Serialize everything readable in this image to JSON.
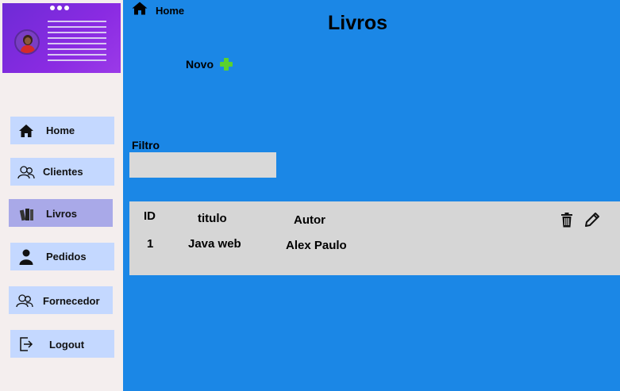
{
  "topbar": {
    "home_label": "Home"
  },
  "page": {
    "title": "Livros"
  },
  "actions": {
    "novo_label": "Novo"
  },
  "filter": {
    "label": "Filtro",
    "value": "",
    "placeholder": ""
  },
  "sidebar": {
    "items": [
      {
        "label": "Home",
        "icon": "home-icon"
      },
      {
        "label": "Clientes",
        "icon": "users-icon"
      },
      {
        "label": "Livros",
        "icon": "books-icon",
        "active": true
      },
      {
        "label": "Pedidos",
        "icon": "person-icon"
      },
      {
        "label": "Fornecedor",
        "icon": "users-icon"
      },
      {
        "label": "Logout",
        "icon": "logout-icon"
      }
    ]
  },
  "table": {
    "columns": [
      "ID",
      "titulo",
      "Autor"
    ],
    "rows": [
      {
        "id": "1",
        "titulo": "Java web",
        "autor": "Alex Paulo"
      }
    ]
  },
  "colors": {
    "main_bg": "#1b87e6",
    "sidebar_bg": "#f4eeee",
    "nav_item_bg": "#c4d8ff",
    "nav_item_active_bg": "#a9a9e8",
    "profile_card_bg": "#7a2fdc",
    "table_bg": "#d6d6d6",
    "plus_icon": "#5bd12e"
  }
}
